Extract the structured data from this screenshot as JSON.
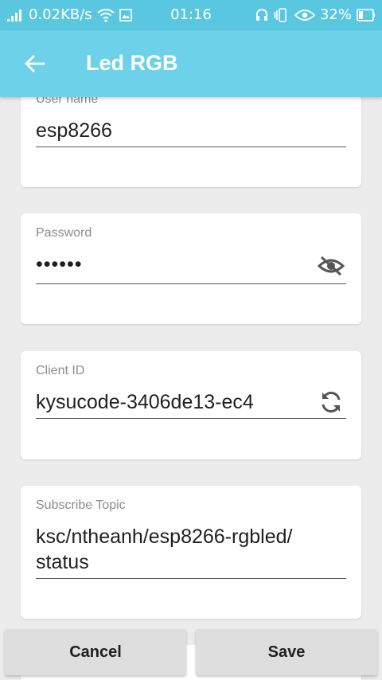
{
  "status_bar": {
    "speed": "0.02KB/s",
    "time": "01:16",
    "battery": "32%",
    "icons": [
      "signal-icon",
      "wifi-icon",
      "image-icon",
      "headset-icon",
      "vibrate-icon",
      "eye-icon",
      "battery-icon"
    ]
  },
  "app_bar": {
    "title": "Led RGB",
    "back_icon": "arrow-left-icon"
  },
  "form": {
    "username": {
      "label": "User name",
      "value": "esp8266"
    },
    "password": {
      "label": "Password",
      "value": "••••••",
      "toggle_icon": "eye-off-icon"
    },
    "client_id": {
      "label": "Client ID",
      "value": "kysucode-3406de13-ec4",
      "refresh_icon": "refresh-icon"
    },
    "subscribe_topic": {
      "label": "Subscribe Topic",
      "value_line1": "ksc/ntheanh/esp8266-rgbled/",
      "value_line2": "status"
    }
  },
  "actions": {
    "cancel_label": "Cancel",
    "save_label": "Save"
  },
  "colors": {
    "status_bar": "#5ac7e0",
    "app_bar": "#6dd1ea",
    "background": "#ececec"
  }
}
